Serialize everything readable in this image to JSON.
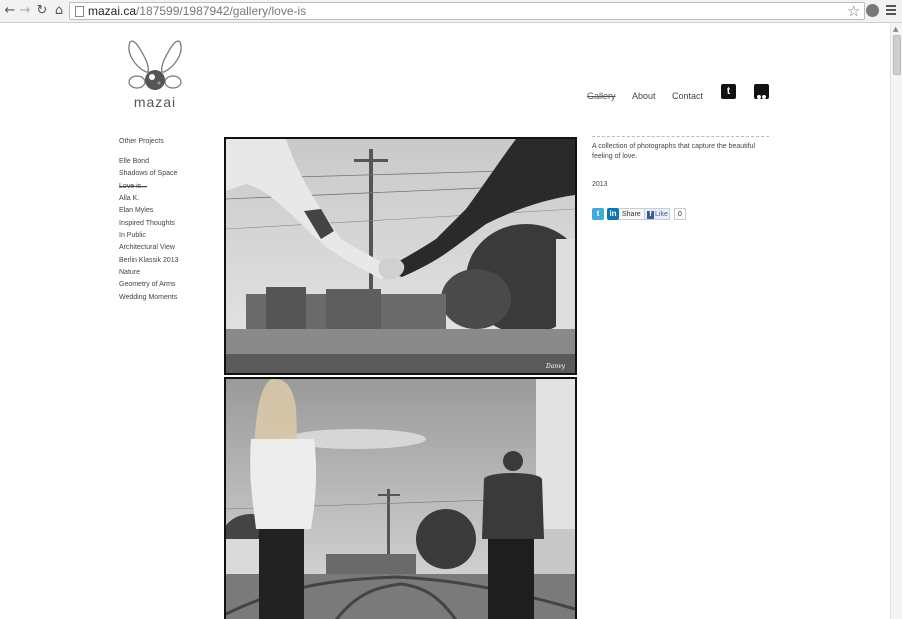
{
  "browser": {
    "url_host": "mazai.ca",
    "url_path": "/187599/1987942/gallery/love-is"
  },
  "logo": {
    "text": "mazai"
  },
  "nav": {
    "gallery": "Gallery",
    "about": "About",
    "contact": "Contact",
    "twitter_glyph": "t",
    "icons": [
      "twitter-icon",
      "flickr-icon"
    ]
  },
  "sidebar": {
    "heading": "Other Projects",
    "items": [
      {
        "label": "Elle Bond"
      },
      {
        "label": "Shadows of Space"
      },
      {
        "label": "Love is..."
      },
      {
        "label": "Alla K."
      },
      {
        "label": "Elan Myles"
      },
      {
        "label": "Inspired Thoughts"
      },
      {
        "label": "In Public"
      },
      {
        "label": "Architectural View"
      },
      {
        "label": "Berlin Klassik 2013"
      },
      {
        "label": "Nature"
      },
      {
        "label": "Geometry of Arms"
      },
      {
        "label": "Wedding Moments"
      }
    ],
    "current_index": 2
  },
  "project": {
    "description": "A collection of photographs that capture the beautiful feeling of love.",
    "year": "2013",
    "share_label": "Share",
    "like_label": "Like",
    "like_count": "0",
    "photo_signature": "Danvy"
  }
}
